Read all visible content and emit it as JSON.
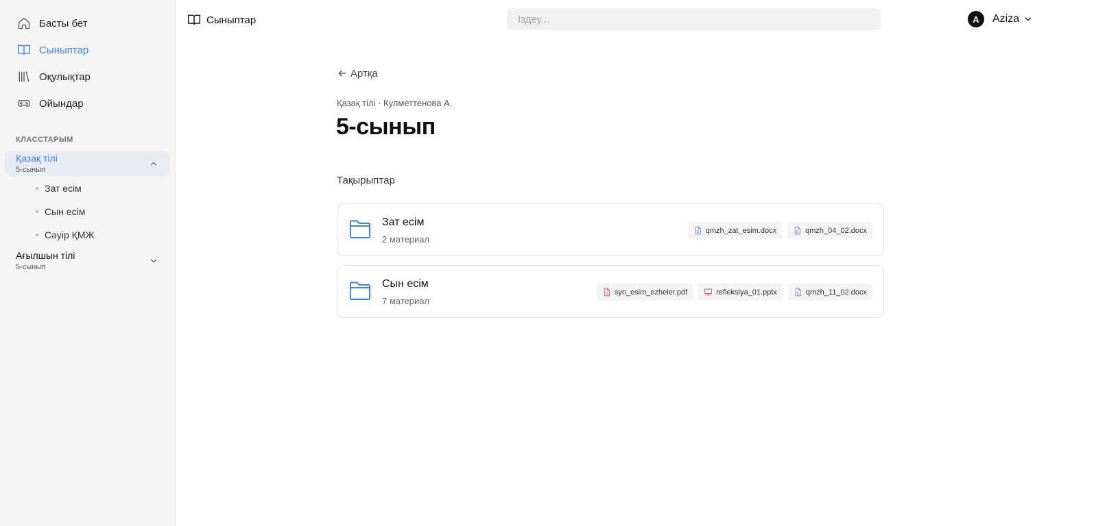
{
  "sidebar": {
    "nav": [
      {
        "label": "Басты бет",
        "icon": "home-icon"
      },
      {
        "label": "Сыныптар",
        "icon": "book-open-icon",
        "active": true
      },
      {
        "label": "Оқулықтар",
        "icon": "library-icon"
      },
      {
        "label": "Ойындар",
        "icon": "gamepad-icon"
      }
    ],
    "section_label": "КЛАССТАРЫМ",
    "classes": [
      {
        "title": "Қазақ тілі",
        "subtitle": "5-сынып",
        "expanded": true,
        "topics": [
          "Зат есім",
          "Сын есім",
          "Сәуір ҚМЖ"
        ]
      },
      {
        "title": "Ағылшын тілі",
        "subtitle": "5-сынып",
        "expanded": false
      }
    ]
  },
  "header": {
    "breadcrumb": "Сыныптар",
    "search_placeholder": "Іздеу...",
    "user": {
      "initial": "A",
      "name": "Aziza"
    }
  },
  "main": {
    "back_label": "Артқа",
    "meta": "Қазақ тілі · Кулметтенова А.",
    "title": "5-сынып",
    "section_title": "Тақырыптар",
    "topics": [
      {
        "title": "Зат есім",
        "count": "2 материал",
        "files": [
          {
            "name": "qmzh_zat_esim.docx",
            "type": "docx"
          },
          {
            "name": "qmzh_04_02.docx",
            "type": "docx"
          }
        ]
      },
      {
        "title": "Сын есім",
        "count": "7 материал",
        "files": [
          {
            "name": "syn_esim_ezheler.pdf",
            "type": "pdf"
          },
          {
            "name": "refleksiya_01.pptx",
            "type": "pptx"
          },
          {
            "name": "qmzh_11_02.docx",
            "type": "docx"
          }
        ]
      }
    ]
  },
  "colors": {
    "accent": "#3b82f6",
    "docx": "#7c93c8",
    "pdf": "#e0584f",
    "pptx": "#e0584f"
  }
}
